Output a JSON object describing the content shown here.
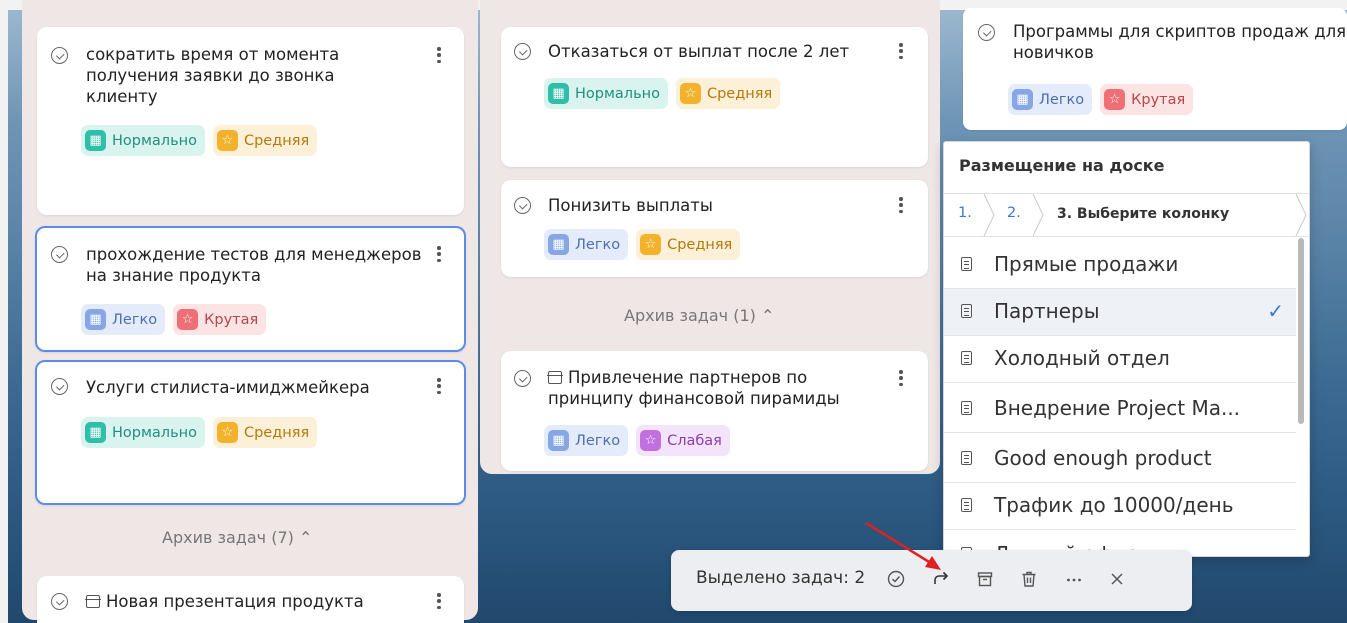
{
  "column1": {
    "cards": [
      {
        "title": "сократить время от момента получения заявки до звонка клиенту",
        "tags": [
          "Нормально",
          "Средняя"
        ]
      },
      {
        "title": "прохождение тестов для менеджеров на знание продукта",
        "tags": [
          "Легко",
          "Крутая"
        ]
      },
      {
        "title": "Услуги стилиста-имиджмейкера",
        "tags": [
          "Нормально",
          "Средняя"
        ]
      }
    ],
    "archive_label": "Архив задач (7)",
    "archived_card": {
      "title": "Новая презентация продукта"
    }
  },
  "column2": {
    "cards": [
      {
        "title": "Отказаться от выплат после 2 лет",
        "tags": [
          "Нормально",
          "Средняя"
        ]
      },
      {
        "title": "Понизить выплаты",
        "tags": [
          "Легко",
          "Средняя"
        ]
      }
    ],
    "archive_label": "Архив задач (1)",
    "archived_card": {
      "title": "Привлечение партнеров по принципу финансовой пирамиды",
      "tags": [
        "Легко",
        "Слабая"
      ]
    }
  },
  "column3": {
    "card": {
      "title": "Программы для скриптов продаж для новичков",
      "tags": [
        "Легко",
        "Крутая"
      ]
    }
  },
  "placement_popup": {
    "title": "Размещение на доске",
    "steps": [
      "1.",
      "2.",
      "3. Выберите колонку"
    ],
    "options": [
      "Прямые продажи",
      "Партнеры",
      "Холодный отдел",
      "Внедрение Project Ma...",
      "Good enough product",
      "Трафик до 10000/день",
      "Лучший офис"
    ],
    "selected_index": 1
  },
  "selection_toolbar": {
    "count_label": "Выделено задач: 2"
  },
  "icons": {
    "check": "check-circle-icon",
    "more": "more-vertical-icon",
    "archive": "archive-box-icon",
    "move": "move-arrow-icon",
    "delete": "trash-icon",
    "close": "close-icon",
    "list": "list-doc-icon"
  },
  "colors": {
    "selected_border": "#5b8de8",
    "link": "#3a78d6",
    "annotation_arrow": "#e02020"
  }
}
